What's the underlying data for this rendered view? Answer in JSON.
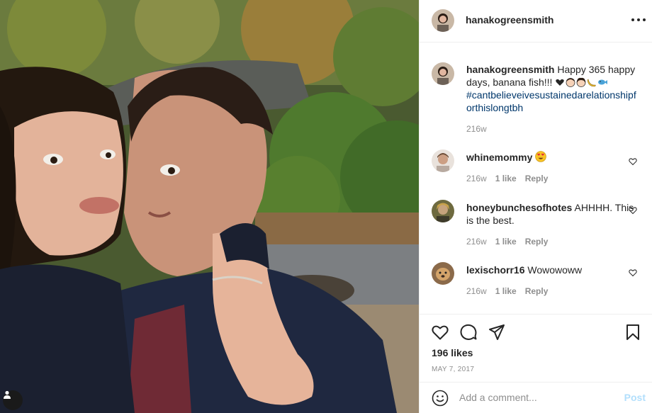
{
  "post": {
    "username": "hanakogreensmith",
    "more_icon": "ellipsis-icon"
  },
  "caption": {
    "username": "hanakogreensmith",
    "text": "Happy 365 happy days, banana fish!!!",
    "emojis": [
      "heart-emoji",
      "boy-emoji",
      "girl-emoji",
      "banana-emoji",
      "fish-emoji"
    ],
    "hashtag": "#cantbelieveivesustainedarelationshipforthislongtbh",
    "age": "216w"
  },
  "comments": [
    {
      "username": "whinemommy",
      "text": "",
      "emoji": "heart-eyes-emoji",
      "age": "216w",
      "likes": "1 like",
      "reply": "Reply"
    },
    {
      "username": "honeybunchesofhotes",
      "text": "AHHHH. This is the best.",
      "age": "216w",
      "likes": "1 like",
      "reply": "Reply"
    },
    {
      "username": "lexischorr16",
      "text": "Wowowoww",
      "age": "216w",
      "likes": "1 like",
      "reply": "Reply"
    }
  ],
  "actions": {
    "like_icon": "heart-icon",
    "comment_icon": "comment-icon",
    "share_icon": "send-icon",
    "save_icon": "bookmark-icon",
    "likes_text": "196 likes",
    "date": "MAY 7, 2017"
  },
  "add_comment": {
    "placeholder": "Add a comment...",
    "post_label": "Post"
  },
  "colors": {
    "text": "#262626",
    "muted": "#8e8e8e",
    "hashtag": "#00376b",
    "post_disabled": "#b2dffc",
    "border": "#efefef"
  }
}
